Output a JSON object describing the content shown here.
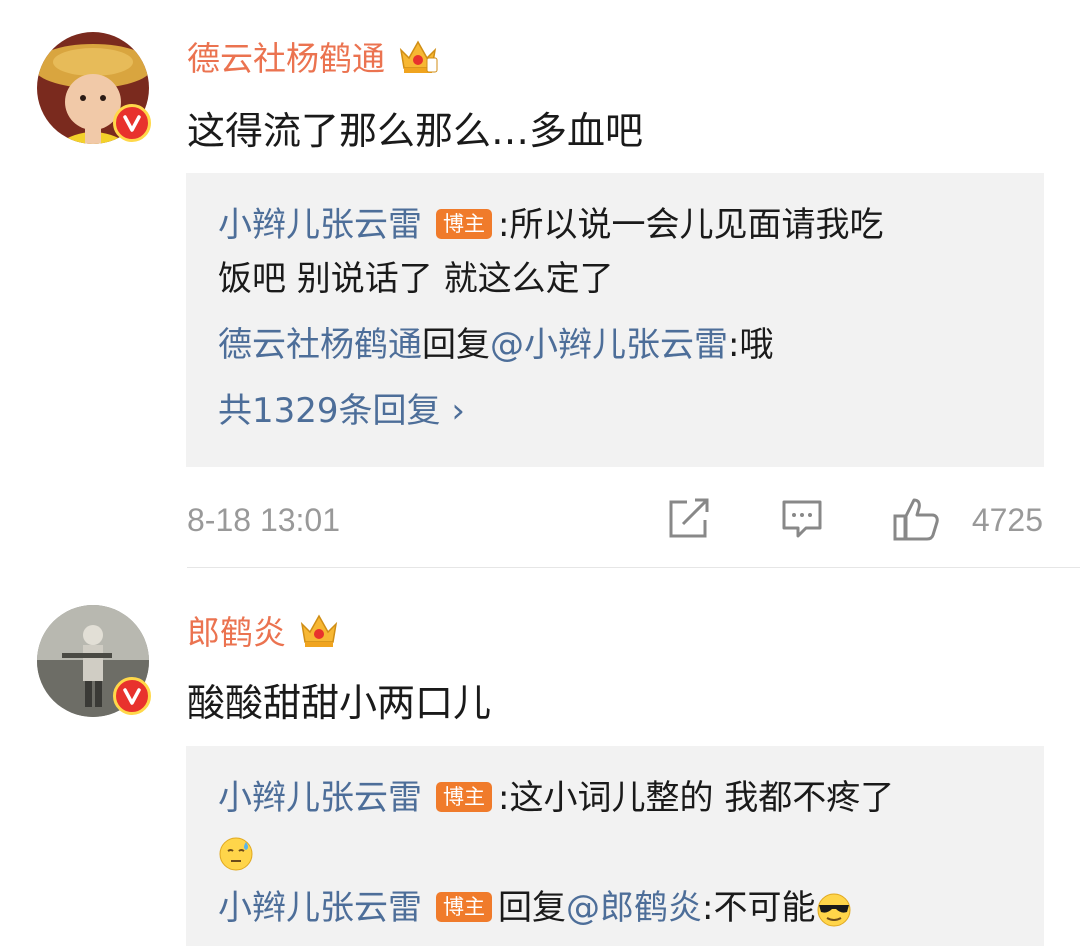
{
  "comments": [
    {
      "username": "德云社杨鹤通",
      "text": "这得流了那么那么…多血吧",
      "replies": {
        "first_author": "小辫儿张云雷",
        "first_tag": "博主",
        "first_text_line1": ":所以说一会儿见面请我吃",
        "first_text_line2": "饭吧 别说话了 就这么定了",
        "second_author": "德云社杨鹤通",
        "second_reply_word": "回复",
        "second_mention": "@小辫儿张云雷",
        "second_text": ":哦",
        "more_link": "共1329条回复 ›"
      },
      "timestamp": "8-18 13:01",
      "like_count": "4725",
      "icons": [
        "verified-badge-icon",
        "crown-icon",
        "repost-icon",
        "comment-icon",
        "like-icon"
      ]
    },
    {
      "username": "郎鹤炎",
      "text": "酸酸甜甜小两口儿",
      "replies": {
        "first_author": "小辫儿张云雷",
        "first_tag": "博主",
        "first_text_line1": ":这小词儿整的 我都不疼了",
        "second_author": "小辫儿张云雷",
        "second_tag": "博主",
        "second_reply_word": "回复",
        "second_mention": "@郎鹤炎",
        "second_text": ":不可能"
      },
      "icons": [
        "verified-badge-icon",
        "crown-icon",
        "sweat-emoji-icon",
        "cool-emoji-icon"
      ]
    }
  ],
  "colors": {
    "username": "#eb7350",
    "link_blue": "#4d6e99",
    "tag_orange": "#f07b2b",
    "reply_bg": "#f2f2f2",
    "meta_gray": "#999999"
  }
}
